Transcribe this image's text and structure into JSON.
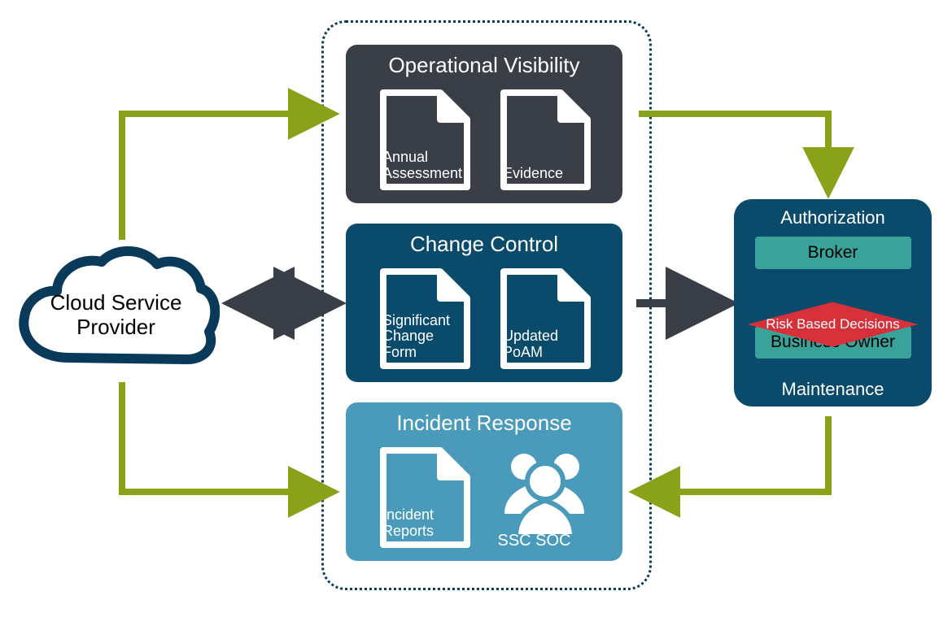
{
  "cloud": {
    "label_l1": "Cloud Service",
    "label_l2": "Provider"
  },
  "panels": {
    "ov": {
      "title": "Operational Visibility",
      "doc1_l1": "Annual",
      "doc1_l2": "Assessment",
      "doc2_l1": "Evidence"
    },
    "cc": {
      "title": "Change Control",
      "doc1_l1": "Significant",
      "doc1_l2": "Change Form",
      "doc2_l1": "Updated",
      "doc2_l2": "PoAM"
    },
    "ir": {
      "title": "Incident Response",
      "doc1_l1": "Incident",
      "doc1_l2": "Reports",
      "people": "SSC SOC"
    }
  },
  "auth": {
    "top": "Authorization",
    "broker": "Broker",
    "decision": "Risk Based Decisions",
    "owner": "Business Owner",
    "bottom": "Maintenance"
  },
  "colors": {
    "olive": "#8aa11a",
    "dark_arrow": "#3a3f47"
  }
}
